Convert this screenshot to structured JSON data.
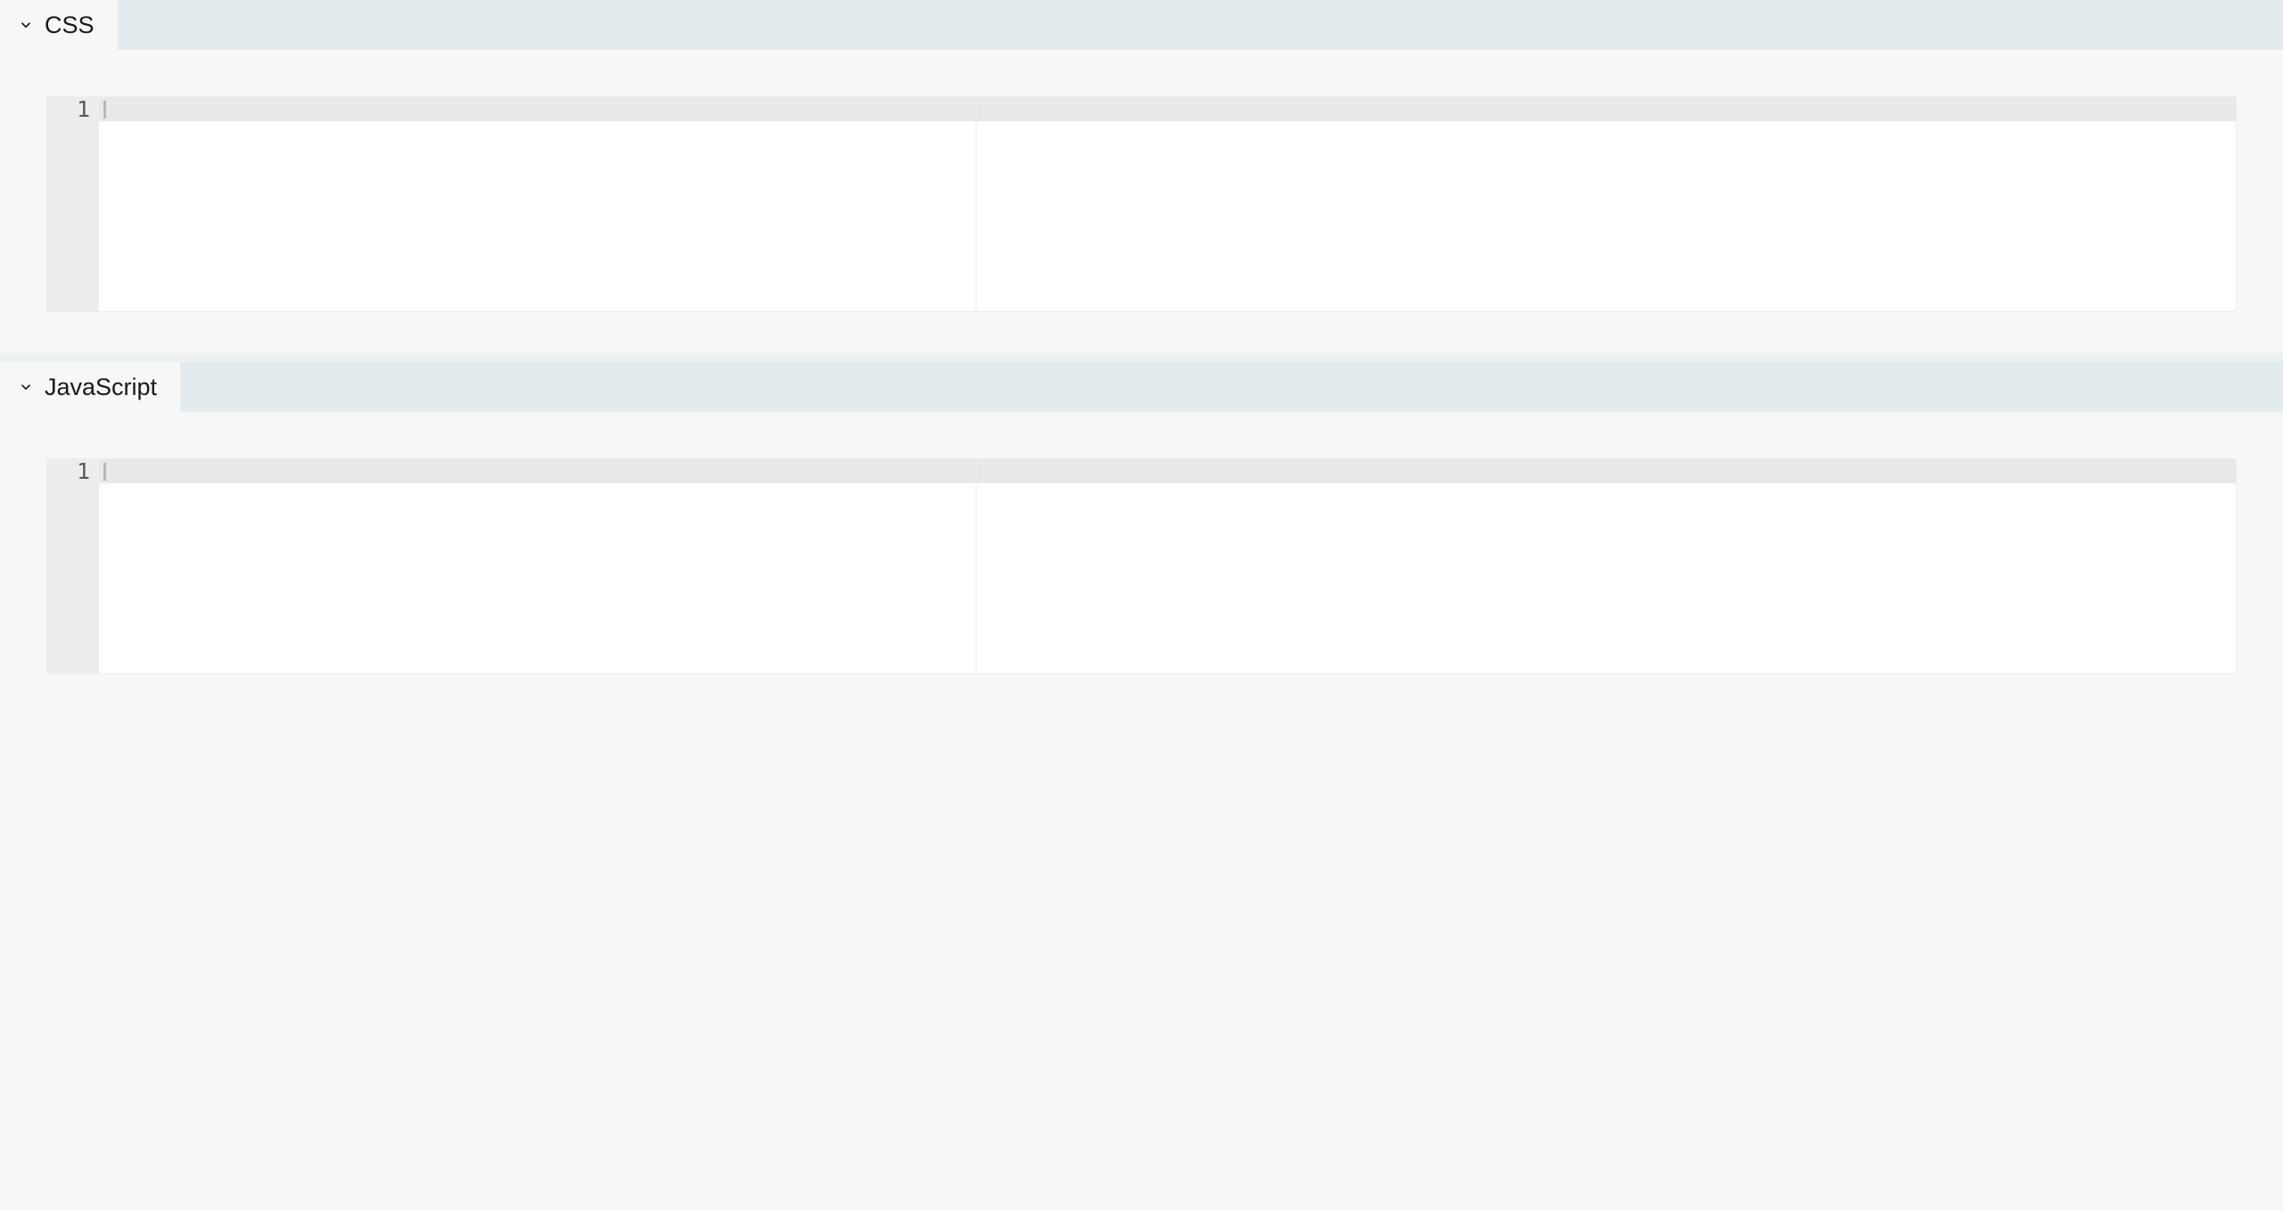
{
  "panels": [
    {
      "label": "CSS",
      "lineNumbers": [
        "1"
      ],
      "content": ""
    },
    {
      "label": "JavaScript",
      "lineNumbers": [
        "1"
      ],
      "content": ""
    }
  ]
}
